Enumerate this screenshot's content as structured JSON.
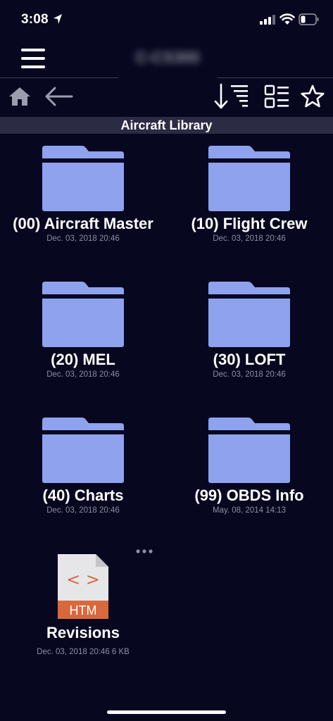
{
  "status_bar": {
    "time": "3:08",
    "icons": [
      "location-arrow-icon",
      "cellular-signal-icon",
      "wifi-icon",
      "battery-icon"
    ]
  },
  "nav": {
    "title": "C-CS300",
    "menu_icon": "hamburger-menu-icon"
  },
  "toolbar": {
    "icons": [
      "home-icon",
      "back-arrow-icon",
      "sort-icon",
      "list-view-icon",
      "star-icon"
    ]
  },
  "section": {
    "title": "Aircraft Library"
  },
  "folders": [
    {
      "name": "(00) Aircraft Master",
      "date": "Dec. 03, 2018 20:46"
    },
    {
      "name": "(10) Flight Crew",
      "date": "Dec. 03, 2018 20:46"
    },
    {
      "name": "(20) MEL",
      "date": "Dec. 03, 2018 20:46"
    },
    {
      "name": "(30) LOFT",
      "date": "Dec. 03, 2018 20:46"
    },
    {
      "name": "(40) Charts",
      "date": "Dec. 03, 2018 20:46"
    },
    {
      "name": "(99) OBDS Info",
      "date": "May. 08, 2014 14:13"
    }
  ],
  "files": [
    {
      "name": "Revisions",
      "meta": "Dec. 03, 2018 20:46 6 KB",
      "type_label": "HTM",
      "code_glyph": "< >"
    }
  ],
  "colors": {
    "background": "#070720",
    "folder": "#8ea2ee",
    "section_header": "#2b2b44",
    "file_badge": "#d9683c"
  }
}
